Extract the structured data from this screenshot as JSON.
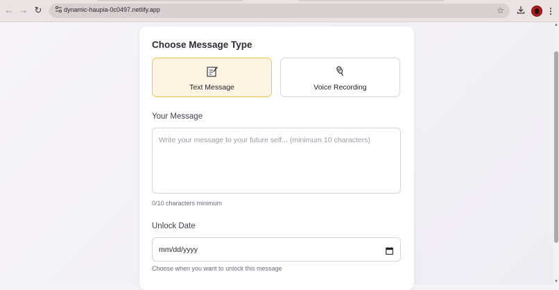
{
  "browser": {
    "url": "dynamic-haupia-0c0497.netlify.app",
    "back_icon": "←",
    "forward_icon": "→",
    "reload_icon": "↻",
    "star_icon": "☆",
    "menu_icon": "⋮"
  },
  "form": {
    "heading": "Choose Message Type",
    "types": [
      {
        "label": "Text Message",
        "icon": "memo-icon",
        "selected": true
      },
      {
        "label": "Voice Recording",
        "icon": "microphone-icon",
        "selected": false
      }
    ],
    "message": {
      "label": "Your Message",
      "placeholder": "Write your message to your future self... (minimum 10 characters)",
      "value": "",
      "counter": "0/10 characters minimum"
    },
    "unlock": {
      "label": "Unlock Date",
      "value": "mm/dd/yyyy",
      "hint": "Choose when you want to unlock this message"
    }
  },
  "colors": {
    "selected_border": "#f0c445",
    "selected_bg": "#fdf4e1",
    "heading": "#2c2c34"
  }
}
